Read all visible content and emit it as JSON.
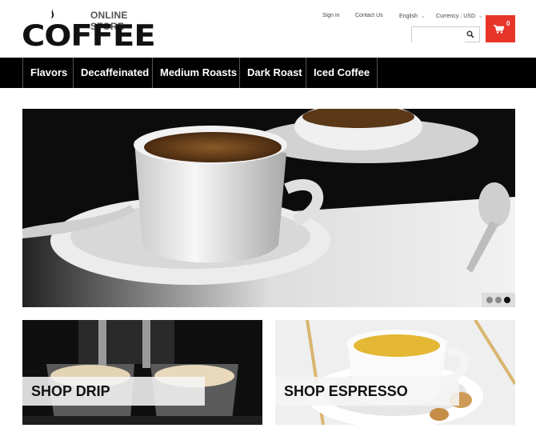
{
  "header": {
    "logo_small": "ONLINE STORE",
    "logo_big": "COFFEE",
    "sign_in": "Sign in",
    "contact_us": "Contact Us",
    "language": "English",
    "currency": "Currency : USD",
    "search_placeholder": "",
    "cart_count": "0"
  },
  "nav": {
    "items": [
      "Flavors",
      "Decaffeinated",
      "Medium Roasts",
      "Dark Roast",
      "Iced Coffee"
    ]
  },
  "slider": {
    "dot_count": 3,
    "active_dot": 3
  },
  "promos": [
    {
      "label": "SHOP DRIP"
    },
    {
      "label": "SHOP ESPRESSO"
    }
  ],
  "colors": {
    "accent": "#e8352a",
    "nav_bg": "#000000"
  }
}
